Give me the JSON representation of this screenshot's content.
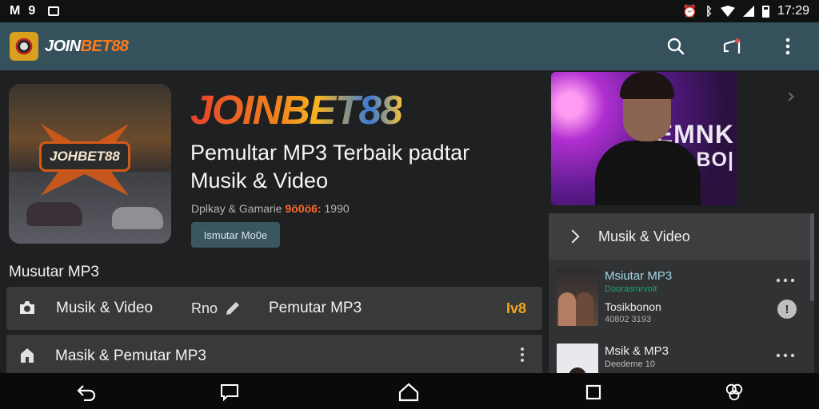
{
  "status_bar": {
    "left_icons": [
      "mail-icon",
      "sim-icon",
      "calendar-icon"
    ],
    "right_icons": [
      "alarm-icon",
      "bluetooth-icon",
      "wifi-icon",
      "signal-icon",
      "battery-icon"
    ],
    "time": "17:29"
  },
  "app_bar": {
    "title_white": "JOIN",
    "title_orange": "BET88",
    "actions": [
      "search-icon",
      "cast-icon",
      "more-vert-icon"
    ],
    "brand_color": "#35525c",
    "accent_color": "#ff7b1c"
  },
  "hero": {
    "art_badge": "JOHBET88",
    "brand_text": "JOINBET88",
    "title": "Pemultar MP3 Terbaik padtar Musik & Video",
    "meta_prefix": "Dplkay & Gamarie",
    "meta_highlight": "9ö0ö6:",
    "meta_suffix": "1990",
    "button_label": "Ismutar Mo0e"
  },
  "section": {
    "title": "Musutar MP3"
  },
  "list": {
    "row1": {
      "icon": "camera-icon",
      "label": "Musik & Video",
      "secondary": "Rno",
      "secondary_icon": "pencil-icon",
      "tertiary": "Pemutar MP3",
      "badge": "Iv8"
    },
    "row2": {
      "icon": "home-icon",
      "label": "Masik & Pemutar MP3",
      "action_icon": "more-vert-icon"
    }
  },
  "feature": {
    "sign_line1": "UEMNK",
    "sign_line2": "BO|"
  },
  "side_panel": {
    "header": "Musik & Video",
    "items": [
      {
        "title": "Msiutar MP3",
        "subtitle": "Doorasmrvolt",
        "line2": "Tosikbonon",
        "line3": "40802 3193",
        "actions": [
          "more-horiz-icon",
          "info-icon"
        ]
      },
      {
        "title": "Msik & MP3",
        "subtitle": "Deedeme 10",
        "actions": [
          "more-horiz-icon"
        ]
      }
    ]
  },
  "nav_bar": {
    "buttons": [
      "back-icon",
      "tab-icon",
      "home-icon",
      "recents-icon",
      "assistant-icon"
    ]
  }
}
